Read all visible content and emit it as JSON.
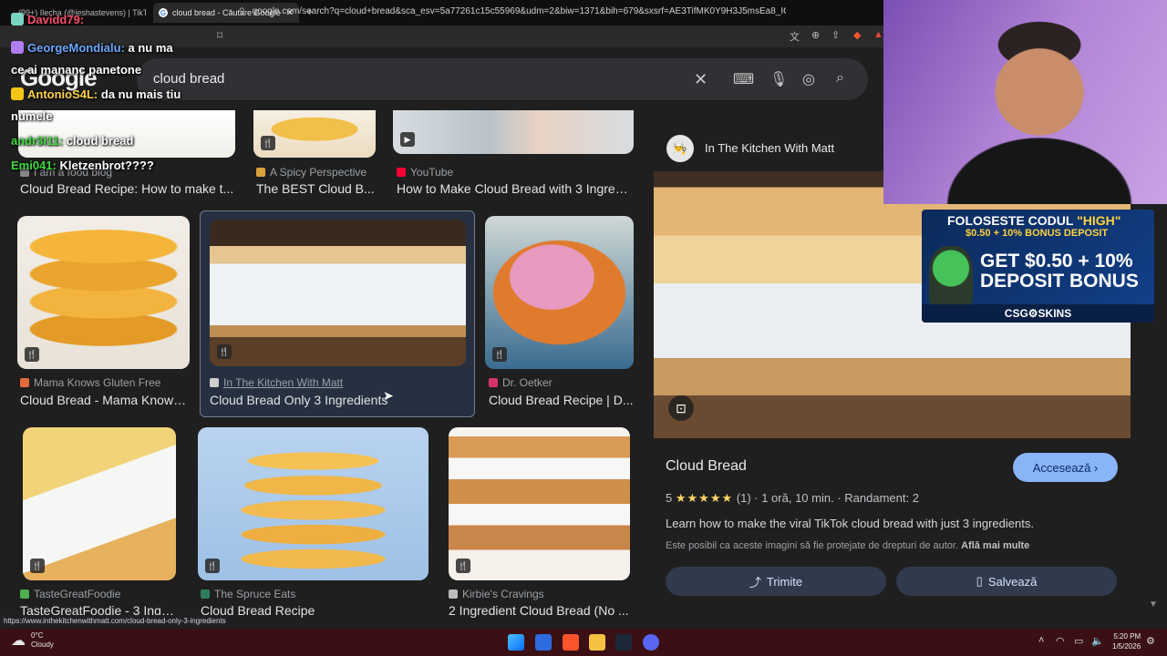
{
  "browser": {
    "tabs": [
      {
        "label": "(99+) Ilecha (@jeshastevens) | TikTok"
      },
      {
        "label": "cloud bread - Căutare Google"
      }
    ],
    "url": "google.com/search?q=cloud+bread&sca_esv=5a77261c15c55969&udm=2&biw=1371&bih=679&sxsrf=AE3TifMK0Y9H3J5msEa8_ICGUe...",
    "status_url": "https://www.inthekitchenwithmatt.com/cloud-bread-only-3-ingredients"
  },
  "search": {
    "logo": "Google",
    "query": "cloud bread"
  },
  "results": {
    "top_row": [
      {
        "source": "I am a food blog",
        "title": "Cloud Bread Recipe: How to make t..."
      },
      {
        "source": "A Spicy Perspective",
        "title": "The BEST Cloud B..."
      },
      {
        "source": "YouTube",
        "title": "How to Make Cloud Bread with 3 Ingredi..."
      }
    ],
    "row2": [
      {
        "source": "Mama Knows Gluten Free",
        "title": "Cloud Bread - Mama Knows..."
      },
      {
        "source": "In The Kitchen With Matt",
        "title": "Cloud Bread Only 3 Ingredients"
      },
      {
        "source": "Dr. Oetker",
        "title": "Cloud Bread Recipe | D..."
      }
    ],
    "row3": [
      {
        "source": "TasteGreatFoodie",
        "title": "TasteGreatFoodie - 3 Ingr..."
      },
      {
        "source": "The Spruce Eats",
        "title": "Cloud Bread Recipe"
      },
      {
        "source": "Kirbie's Cravings",
        "title": "2 Ingredient Cloud Bread (No ..."
      }
    ]
  },
  "preview": {
    "source": "In The Kitchen With Matt",
    "title": "Cloud Bread",
    "visit_label": "Accesează",
    "rating_value": "5",
    "stars": "★★★★★",
    "rating_count": "(1)",
    "time": "1 oră, 10 min.",
    "yield": "Randament: 2",
    "description": "Learn how to make the viral TikTok cloud bread with just 3 ingredients.",
    "copyright": "Este posibil ca aceste imagini să fie protejate de drepturi de autor.",
    "learn_more": "Află mai multe",
    "share_label": "Trimite",
    "save_label": "Salvează"
  },
  "chat": [
    {
      "user": "Davidd79:",
      "text": "",
      "color": "#ff4d6d"
    },
    {
      "user": "GeorgeMondialu:",
      "text": "a nu ma",
      "color": "#6aa8ff"
    },
    {
      "user": "",
      "text": "ce ai mananc panetone",
      "color": "#ffffff"
    },
    {
      "user": "AntonioS4L:",
      "text": "da nu mais tiu",
      "color": "#ffd24a"
    },
    {
      "user": "",
      "text": "numele",
      "color": "#ffffff"
    },
    {
      "user": "andr3i11:",
      "text": "cloud bread",
      "color": "#3ddc3d"
    },
    {
      "user": "Emi041:",
      "text": "Kletzenbrot????",
      "color": "#3ddc3d"
    }
  ],
  "ad": {
    "line1_prefix": "FOLOSESTE CODUL",
    "line1_code": "\"HIGH\"",
    "line2": "$0.50 + 10% BONUS DEPOSIT",
    "line3a": "GET $0.50 + 10%",
    "line3b": "DEPOSIT BONUS",
    "brand": "CSG⚙SKINS"
  },
  "taskbar": {
    "temp": "0°C",
    "weather": "Cloudy",
    "time": "5:20 PM",
    "date": "1/5/2026"
  }
}
